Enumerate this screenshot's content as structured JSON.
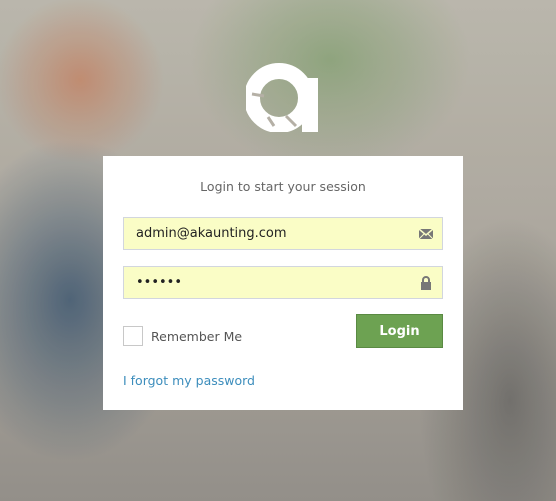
{
  "brand": {
    "logo_icon": "akaunting-logo-icon",
    "accent_color": "#6da252",
    "link_color": "#3c8dbc"
  },
  "login": {
    "title": "Login to start your session",
    "email_value": "admin@akaunting.com",
    "email_icon": "envelope-icon",
    "password_value": "••••••",
    "password_icon": "lock-icon",
    "remember_label": "Remember Me",
    "remember_checked": false,
    "login_button": "Login",
    "forgot_link": "I forgot my password"
  }
}
